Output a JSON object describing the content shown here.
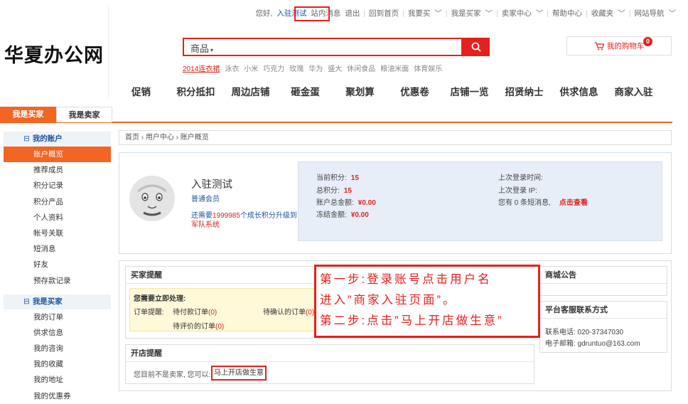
{
  "topbar": {
    "greeting": "您好,",
    "user_link": "入驻测试",
    "links": [
      "站内消息",
      "退出",
      "回到首页",
      "我要买",
      "我是买家",
      "卖家中心",
      "帮助中心",
      "收藏夹",
      "网站导航"
    ]
  },
  "logo": {
    "text": "华夏办公网"
  },
  "search": {
    "category": "商品",
    "hotwords": [
      "2014连衣裙",
      "泳衣",
      "小米",
      "巧克力",
      "玫瑰",
      "华为",
      "盛大",
      "休闲食品",
      "粮油米面",
      "体育娱乐"
    ]
  },
  "cart": {
    "label": "我的购物车",
    "count": "0"
  },
  "nav": [
    "促销",
    "积分抵扣",
    "周边店铺",
    "砸金蛋",
    "聚划算",
    "优惠卷",
    "店铺一览",
    "招贤纳士",
    "供求信息",
    "商家入驻"
  ],
  "tabs": {
    "buyer": "我是买家",
    "seller": "我是卖家"
  },
  "sidebar": {
    "section1": "我的账户",
    "items1": [
      "账户概览",
      "推荐成员",
      "积分记录",
      "积分产品",
      "个人资料",
      "帐号关联",
      "短消息",
      "好友",
      "预存款记录"
    ],
    "section2": "我是买家",
    "items2": [
      "我的订单",
      "供求信息",
      "我的咨询",
      "我的收藏",
      "我的地址",
      "我的优惠券"
    ]
  },
  "breadcrumb": "首页 › 用户中心 › 账户概览",
  "account": {
    "name": "入驻测试",
    "level": "普通会员",
    "upgrade_pre": "还需要",
    "upgrade_num": "1999985",
    "upgrade_mid": "个成长积分升级到",
    "upgrade_target": "军队系统",
    "current_points_label": "当前积分:",
    "current_points": "15",
    "total_points_label": "总积分:",
    "total_points": "15",
    "balance_label": "账户总金额:",
    "balance": "¥0.00",
    "frozen_label": "冻结金额:",
    "frozen": "¥0.00",
    "last_login_label": "上次登录时间:",
    "last_ip_label": "上次登录 IP:",
    "messages": "您有 0 条短消息,",
    "view_now": "点击查看"
  },
  "buyer_panel": {
    "title": "买家提醒",
    "todo": "您需要立即处理:",
    "order_label": "订单提醒:",
    "pending_pay": "待付款订单",
    "pending_pay_count": "(0)",
    "pending_confirm": "待确认的订单",
    "pending_confirm_count": "(0)",
    "pending_review": "待评价的订单",
    "pending_review_count": "(0)"
  },
  "shop_panel": {
    "title": "开店提醒",
    "message": "您目前不是卖家, 您可以:",
    "button": "马上开店做生意"
  },
  "notice_panel": {
    "title": "商城公告"
  },
  "service_panel": {
    "title": "平台客服联系方式",
    "phone": "联系电话: 020-37347030",
    "email": "电子邮箱: gdruntuo@163.com"
  },
  "callout": {
    "line1": "第一步:登录账号点击用户名",
    "line2": "进入”商家入驻页面”。",
    "line3": "第二步:点击”马上开店做生意”"
  },
  "colors": {
    "brand_orange": "#f26522",
    "highlight_red": "#e4211d",
    "link_blue": "#1e55a0"
  }
}
